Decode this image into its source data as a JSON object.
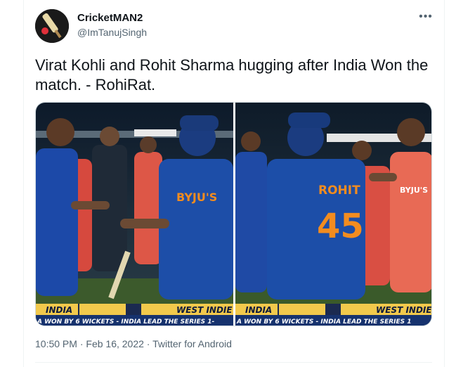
{
  "author": {
    "display_name": "CricketMAN2",
    "handle": "@ImTanujSingh",
    "avatar_icon": "cricket-bat-ball-icon"
  },
  "more_icon": "more-options-icon",
  "tweet": {
    "text": "Virat Kohli and Rohit Sharma hugging after India Won the match. - RohiRat."
  },
  "media": {
    "left_photo": {
      "sponsor_text": "BYJU'S",
      "scorebar_team_left": "INDIA",
      "scorebar_team_right": "WEST INDIE",
      "ticker": "A WON BY 6 WICKETS - INDIA LEAD THE SERIES 1-"
    },
    "right_photo": {
      "jersey_name": "ROHIT",
      "jersey_number": "45",
      "sponsor_text": "BYJU'S",
      "scorebar_team_left": "INDIA",
      "scorebar_team_right": "WEST INDIE",
      "ticker": "A WON BY 6 WICKETS - INDIA LEAD THE SERIES 1"
    }
  },
  "meta": {
    "time": "10:50 PM",
    "date": "Feb 16, 2022",
    "source": "Twitter for Android",
    "separator": "·"
  }
}
